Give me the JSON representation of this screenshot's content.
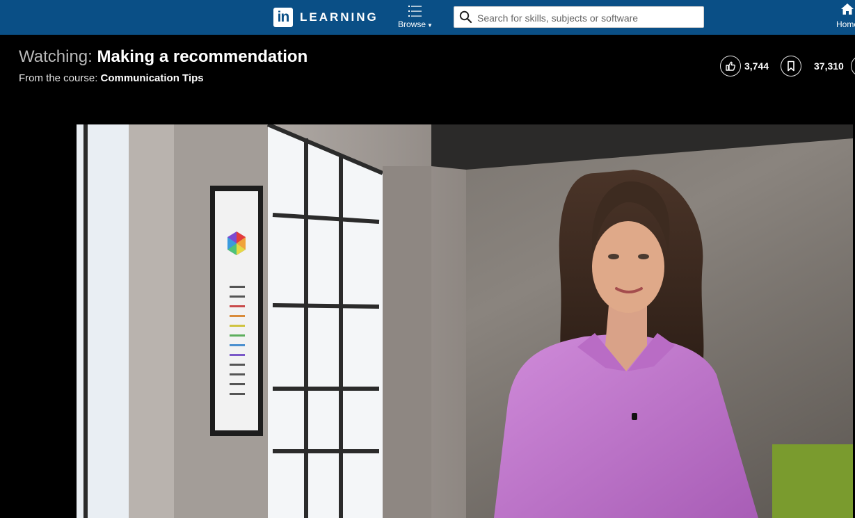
{
  "app": {
    "logo_mark": "in",
    "logo_text": "LEARNING"
  },
  "nav": {
    "browse_label": "Browse",
    "browse_icon": "list-menu-icon",
    "search_placeholder": "Search for skills, subjects or software",
    "home_label": "Home"
  },
  "header": {
    "title_prefix": "Watching:",
    "title": "Making a recommendation",
    "course_prefix": "From the course:",
    "course_name": "Communication Tips"
  },
  "stats": {
    "likes": "3,744",
    "saves": "37,310"
  },
  "colors": {
    "nav_bg": "#0a4f86",
    "page_bg": "#000000",
    "shirt": "#c47ad0"
  },
  "video": {
    "scene": "presenter"
  }
}
